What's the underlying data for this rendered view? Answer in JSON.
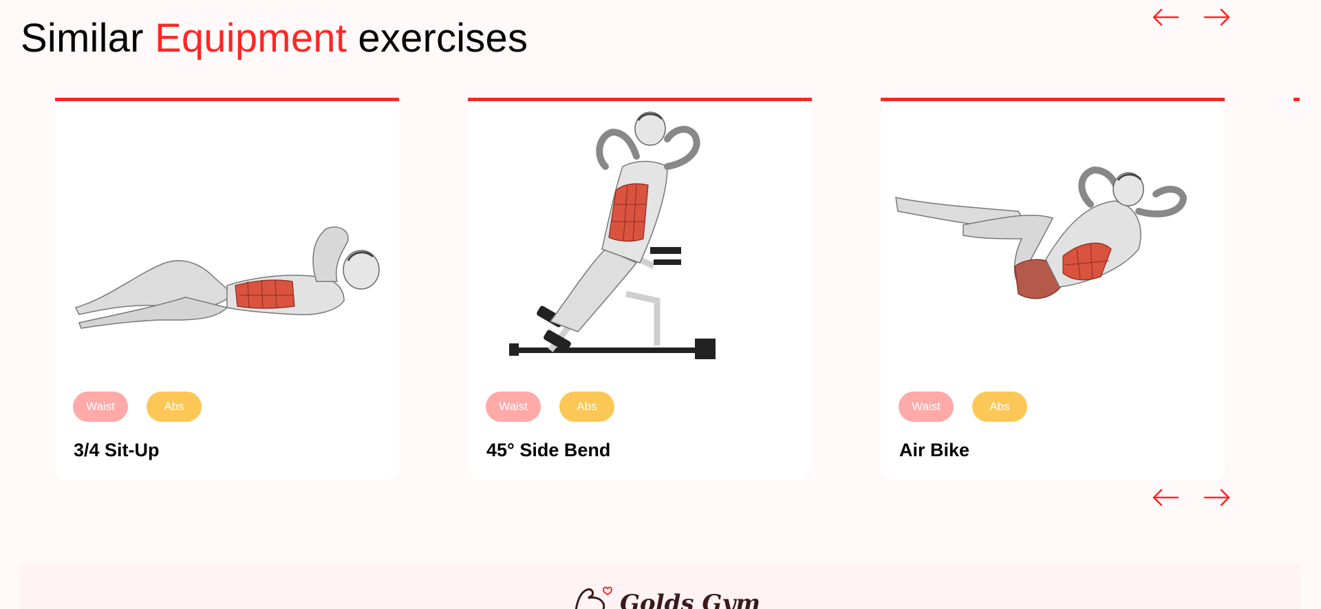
{
  "section": {
    "title_part1": "Similar",
    "title_accent": "Equipment",
    "title_part2": "exercises"
  },
  "colors": {
    "accent": "#ff2625",
    "bodypart_chip": "#ffa9a9",
    "target_chip": "#fcc757",
    "background": "#fff9f9",
    "footer_bg": "#fff3f4"
  },
  "icons": {
    "prev": "left-arrow-icon",
    "next": "right-arrow-icon",
    "logo": "flexed-arm-heart-icon"
  },
  "exercises": [
    {
      "name": "3/4 Sit-Up",
      "body_part": "Waist",
      "target": "Abs",
      "illustration": "sit-up-illustration"
    },
    {
      "name": "45° Side Bend",
      "body_part": "Waist",
      "target": "Abs",
      "illustration": "side-bend-bench-illustration"
    },
    {
      "name": "Air Bike",
      "body_part": "Waist",
      "target": "Abs",
      "illustration": "air-bike-illustration"
    }
  ],
  "footer": {
    "logo_text": "Golds Gym"
  }
}
